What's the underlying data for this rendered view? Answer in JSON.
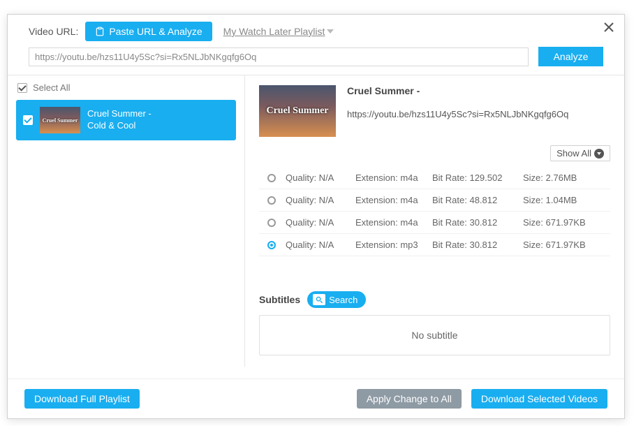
{
  "header": {
    "label": "Video URL:",
    "paste_label": "Paste URL & Analyze",
    "watch_later": "My Watch Later Playlist"
  },
  "url_input": "https://youtu.be/hzs11U4y5Sc?si=Rx5NLJbNKgqfg6Oq",
  "analyze_label": "Analyze",
  "sidebar": {
    "select_all": "Select All",
    "items": [
      {
        "title1": "Cruel Summer -",
        "title2": "Cold & Cool",
        "thumb_text": "Cruel Summer"
      }
    ]
  },
  "main": {
    "title": "Cruel Summer -",
    "url": "https://youtu.be/hzs11U4y5Sc?si=Rx5NLJbNKgqfg6Oq",
    "thumb_text": "Cruel Summer",
    "show_all": "Show All",
    "labels": {
      "quality": "Quality:",
      "extension": "Extension:",
      "bitrate": "Bit Rate:",
      "size": "Size:"
    },
    "formats": [
      {
        "quality": "N/A",
        "extension": "m4a",
        "bitrate": "129.502",
        "size": "2.76MB",
        "selected": false
      },
      {
        "quality": "N/A",
        "extension": "m4a",
        "bitrate": "48.812",
        "size": "1.04MB",
        "selected": false
      },
      {
        "quality": "N/A",
        "extension": "m4a",
        "bitrate": "30.812",
        "size": "671.97KB",
        "selected": false
      },
      {
        "quality": "N/A",
        "extension": "mp3",
        "bitrate": "30.812",
        "size": "671.97KB",
        "selected": true
      }
    ],
    "subtitles_label": "Subtitles",
    "subtitles_search": "Search",
    "no_subtitle": "No subtitle"
  },
  "footer": {
    "download_full": "Download Full Playlist",
    "apply_change": "Apply Change to All",
    "download_selected": "Download Selected Videos"
  }
}
